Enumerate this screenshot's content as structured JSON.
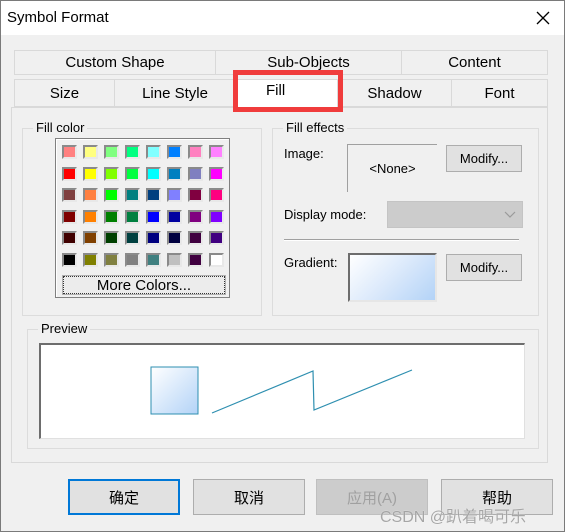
{
  "window": {
    "title": "Symbol Format",
    "close_icon": "close-icon"
  },
  "tabs": {
    "row_top": [
      {
        "label": "Custom Shape"
      },
      {
        "label": "Sub-Objects"
      },
      {
        "label": "Content"
      }
    ],
    "row_bottom": [
      {
        "label": "Size"
      },
      {
        "label": "Line Style"
      },
      {
        "label": "Fill",
        "active": true
      },
      {
        "label": "Shadow"
      },
      {
        "label": "Font"
      }
    ]
  },
  "fill_color": {
    "group_label": "Fill color",
    "swatches": [
      [
        "#ff8080",
        "#ffff80",
        "#80ff80",
        "#00ff80",
        "#80ffff",
        "#0080ff",
        "#ff80c0",
        "#ff80ff"
      ],
      [
        "#ff0000",
        "#ffff00",
        "#80ff00",
        "#00ff40",
        "#00ffff",
        "#0080c0",
        "#8080c0",
        "#ff00ff"
      ],
      [
        "#804040",
        "#ff8040",
        "#00ff00",
        "#008080",
        "#004080",
        "#8080ff",
        "#800040",
        "#ff0080"
      ],
      [
        "#800000",
        "#ff8000",
        "#008000",
        "#008040",
        "#0000ff",
        "#0000a0",
        "#800080",
        "#8000ff"
      ],
      [
        "#400000",
        "#804000",
        "#004000",
        "#004040",
        "#000080",
        "#000040",
        "#400040",
        "#400080"
      ],
      [
        "#000000",
        "#808000",
        "#808040",
        "#808080",
        "#408080",
        "#c0c0c0",
        "#400040",
        "#ffffff"
      ]
    ],
    "more_colors_label": "More Colors..."
  },
  "fill_effects": {
    "group_label": "Fill effects",
    "image_label": "Image:",
    "image_value": "<None>",
    "image_modify_label": "Modify...",
    "display_mode_label": "Display mode:",
    "display_mode_value": "",
    "gradient_label": "Gradient:",
    "gradient_modify_label": "Modify...",
    "gradient_colors": [
      "#ffffff",
      "#b3d3f7"
    ]
  },
  "preview": {
    "group_label": "Preview",
    "shape_fill": [
      "#ffffff",
      "#b3d3f7"
    ],
    "shape_stroke": "#2e8fb0",
    "line_color": "#2e8fb0"
  },
  "buttons": {
    "ok_label": "确定",
    "cancel_label": "取消",
    "apply_label": "应用(A)",
    "help_label": "帮助"
  },
  "watermark": "CSDN @趴着喝可乐"
}
